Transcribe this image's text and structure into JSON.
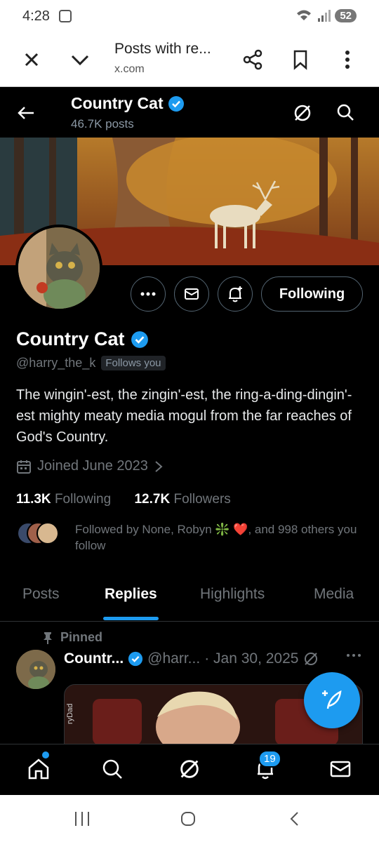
{
  "status_bar": {
    "time": "4:28",
    "battery": "52"
  },
  "browser": {
    "title": "Posts with re...",
    "domain": "x.com"
  },
  "header": {
    "name": "Country Cat",
    "post_count": "46.7K posts"
  },
  "profile": {
    "name": "Country Cat",
    "handle": "@harry_the_k",
    "follows_you": "Follows you",
    "bio": "The wingin'-est, the zingin'-est, the ring-a-ding-dingin'-est mighty meaty media mogul from the far reaches of God's Country.",
    "joined": "Joined June 2023",
    "following_count": "11.3K",
    "following_label": "Following",
    "followers_count": "12.7K",
    "followers_label": "Followers",
    "followed_by": "Followed by None, Robyn ❇️ ❤️, and 998 others you follow",
    "follow_button": "Following"
  },
  "tabs": [
    {
      "label": "Posts",
      "active": false
    },
    {
      "label": "Replies",
      "active": true
    },
    {
      "label": "Highlights",
      "active": false
    },
    {
      "label": "Media",
      "active": false
    }
  ],
  "pinned_post": {
    "pinned_label": "Pinned",
    "author": "Countr...",
    "handle": "@harr...",
    "date": "· Jan 30, 2025",
    "media_watermark": "ryDad"
  },
  "bottom_nav": {
    "notifications_badge": "19"
  },
  "colors": {
    "accent": "#1d9bf0",
    "background": "#000000",
    "muted": "#71767b"
  }
}
